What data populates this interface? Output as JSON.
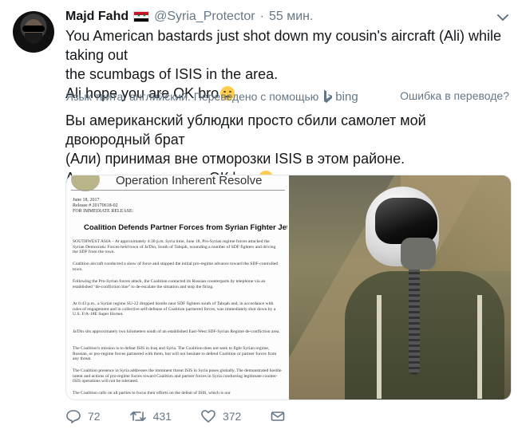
{
  "tweet": {
    "author_name": "Majd Fahd",
    "handle": "@Syria_Protector",
    "separator": "·",
    "time": "55 мин.",
    "lines": [
      "You American bastards just shot down my cousin's aircraft (Ali) while taking out",
      "the scumbags of ISIS in the area.",
      "Ali hope you are OK bro"
    ],
    "emoji_icon": "disappointed-face-emoji"
  },
  "translation": {
    "info": "Язык твита: английский. Переведено с помощью",
    "provider": "bing",
    "wrong_link": "Ошибка в переводе?",
    "lines": [
      "Вы американский ублюдки просто сбили самолет мой двоюродный брат",
      "(Али) принимая вне отморозки ISIS в этом районе.",
      "Али надеюсь, что вы ОК bro"
    ]
  },
  "media": {
    "document": {
      "org": "Operation Inherent Resolve",
      "date": "June 18, 2017",
      "release": "Release # 20170618-02",
      "immediate": "FOR IMMEDIATE RELEASE:",
      "headline": "Coalition Defends Partner Forces from Syrian Fighter Jet Attack",
      "paragraphs": [
        "SOUTHWEST ASIA – At approximately 4:30 p.m. Syria time, June 18, Pro-Syrian regime forces attacked the Syrian Democratic Forces-held town of Ja'Din, South of Tabqah, wounding a number of SDF fighters and driving the SDF from the town.",
        "Coalition aircraft conducted a show of force and stopped the initial pro-regime advance toward the SDF-controlled town.",
        "Following the Pro-Syrian forces attack, the Coalition contacted its Russian counterparts by telephone via an established \"de-confliction line\" to de-escalate the situation and stop the firing.",
        "At 6:43 p.m., a Syrian regime SU-22 dropped bombs near SDF fighters south of Tabqah and, in accordance with rules of engagement and in collective self-defense of Coalition partnered forces, was immediately shot down by a U.S. F/A-18E Super Hornet.",
        "Ja'Din sits approximately two kilometers south of an established East-West SDF-Syrian Regime de-confliction area.",
        "The Coalition's mission is to defeat ISIS in Iraq and Syria. The Coalition does not seek to fight Syrian regime, Russian, or pro-regime forces partnered with them, but will not hesitate to defend Coalition or partner forces from any threat.",
        "The Coalition presence in Syria addresses the imminent threat ISIS in Syria poses globally. The demonstrated hostile intent and actions of pro-regime forces toward Coalition and partner forces in Syria conducting legitimate counter-ISIS operations will not be tolerated.",
        "The Coalition calls on all parties to focus their efforts on the defeat of ISIS, which is our"
      ]
    },
    "photo_subject": "pilot-in-helmet"
  },
  "actions": {
    "reply_count": "72",
    "retweet_count": "431",
    "like_count": "372"
  },
  "colors": {
    "text": "#14171a",
    "secondary": "#657786",
    "border": "#e1e8ed"
  }
}
